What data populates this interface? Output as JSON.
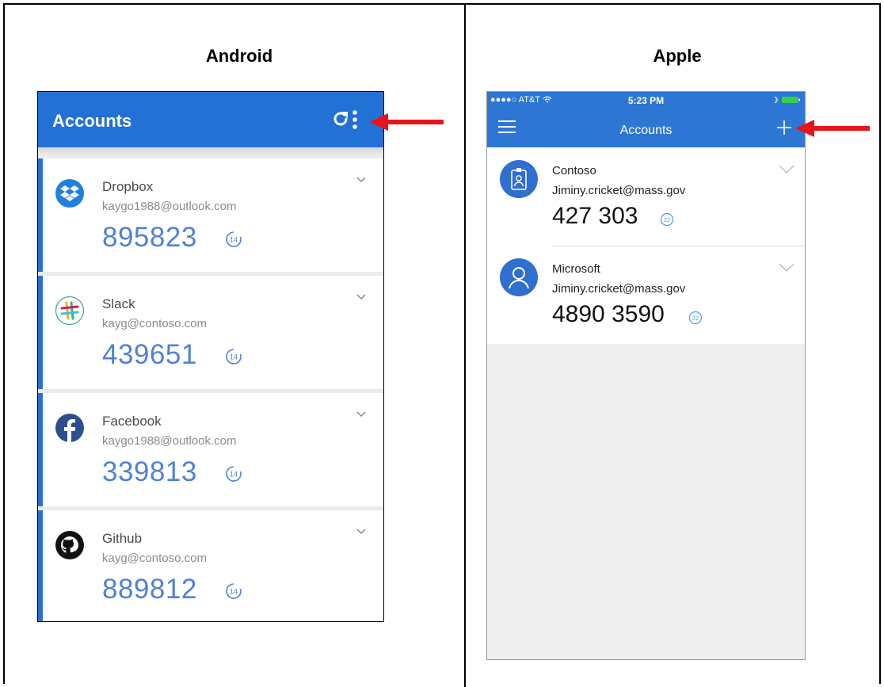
{
  "labels": {
    "left": "Android",
    "right": "Apple"
  },
  "android": {
    "title": "Accounts",
    "accounts": [
      {
        "name": "Dropbox",
        "email": "kaygo1988@outlook.com",
        "code": "895823",
        "seconds": "14",
        "icon": "dropbox-icon"
      },
      {
        "name": "Slack",
        "email": "kayg@contoso.com",
        "code": "439651",
        "seconds": "14",
        "icon": "slack-icon"
      },
      {
        "name": "Facebook",
        "email": "kaygo1988@outlook.com",
        "code": "339813",
        "seconds": "14",
        "icon": "facebook-icon"
      },
      {
        "name": "Github",
        "email": "kayg@contoso.com",
        "code": "889812",
        "seconds": "14",
        "icon": "github-icon"
      }
    ],
    "icons": {
      "refresh": "refresh-icon",
      "menu": "more-vertical-icon",
      "expand": "chevron-down-icon"
    }
  },
  "apple": {
    "status": {
      "carrier": "●●●●○ AT&T",
      "time": "5:23 PM"
    },
    "title": "Accounts",
    "accounts": [
      {
        "name": "Contoso",
        "email": "Jiminy.cricket@mass.gov",
        "code": "427 303",
        "seconds": "22",
        "icon": "badge-icon"
      },
      {
        "name": "Microsoft",
        "email": "Jiminy.cricket@mass.gov",
        "code": "4890 3590",
        "seconds": "22",
        "icon": "person-icon"
      }
    ],
    "icons": {
      "menu": "hamburger-icon",
      "add": "plus-icon",
      "expand": "chevron-down-icon"
    }
  },
  "colors": {
    "android_bar": "#2271d4",
    "apple_bar": "#2e76d3",
    "code_blue": "#4f82d6",
    "arrow": "#e8141b"
  }
}
